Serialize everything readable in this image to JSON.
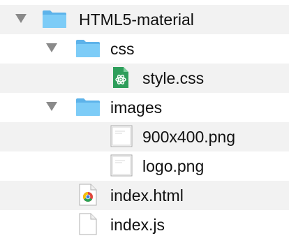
{
  "file_tree": {
    "root": {
      "label": "HTML5-material",
      "icon": "folder-icon",
      "expanded": true
    },
    "css_folder": {
      "label": "css",
      "icon": "folder-icon",
      "expanded": true
    },
    "style_css": {
      "label": "style.css",
      "icon": "css-file-icon"
    },
    "images_folder": {
      "label": "images",
      "icon": "folder-icon",
      "expanded": true
    },
    "image_900x400": {
      "label": "900x400.png",
      "icon": "image-file-icon"
    },
    "logo_png": {
      "label": "logo.png",
      "icon": "image-file-icon"
    },
    "index_html": {
      "label": "index.html",
      "icon": "chrome-html-file-icon"
    },
    "index_js": {
      "label": "index.js",
      "icon": "blank-file-icon"
    }
  },
  "colors": {
    "folder_blue": "#6ec3f4",
    "stripe": "#f2f2f2",
    "disclosure": "#8a8a8a",
    "css_green": "#2e9e5b"
  }
}
